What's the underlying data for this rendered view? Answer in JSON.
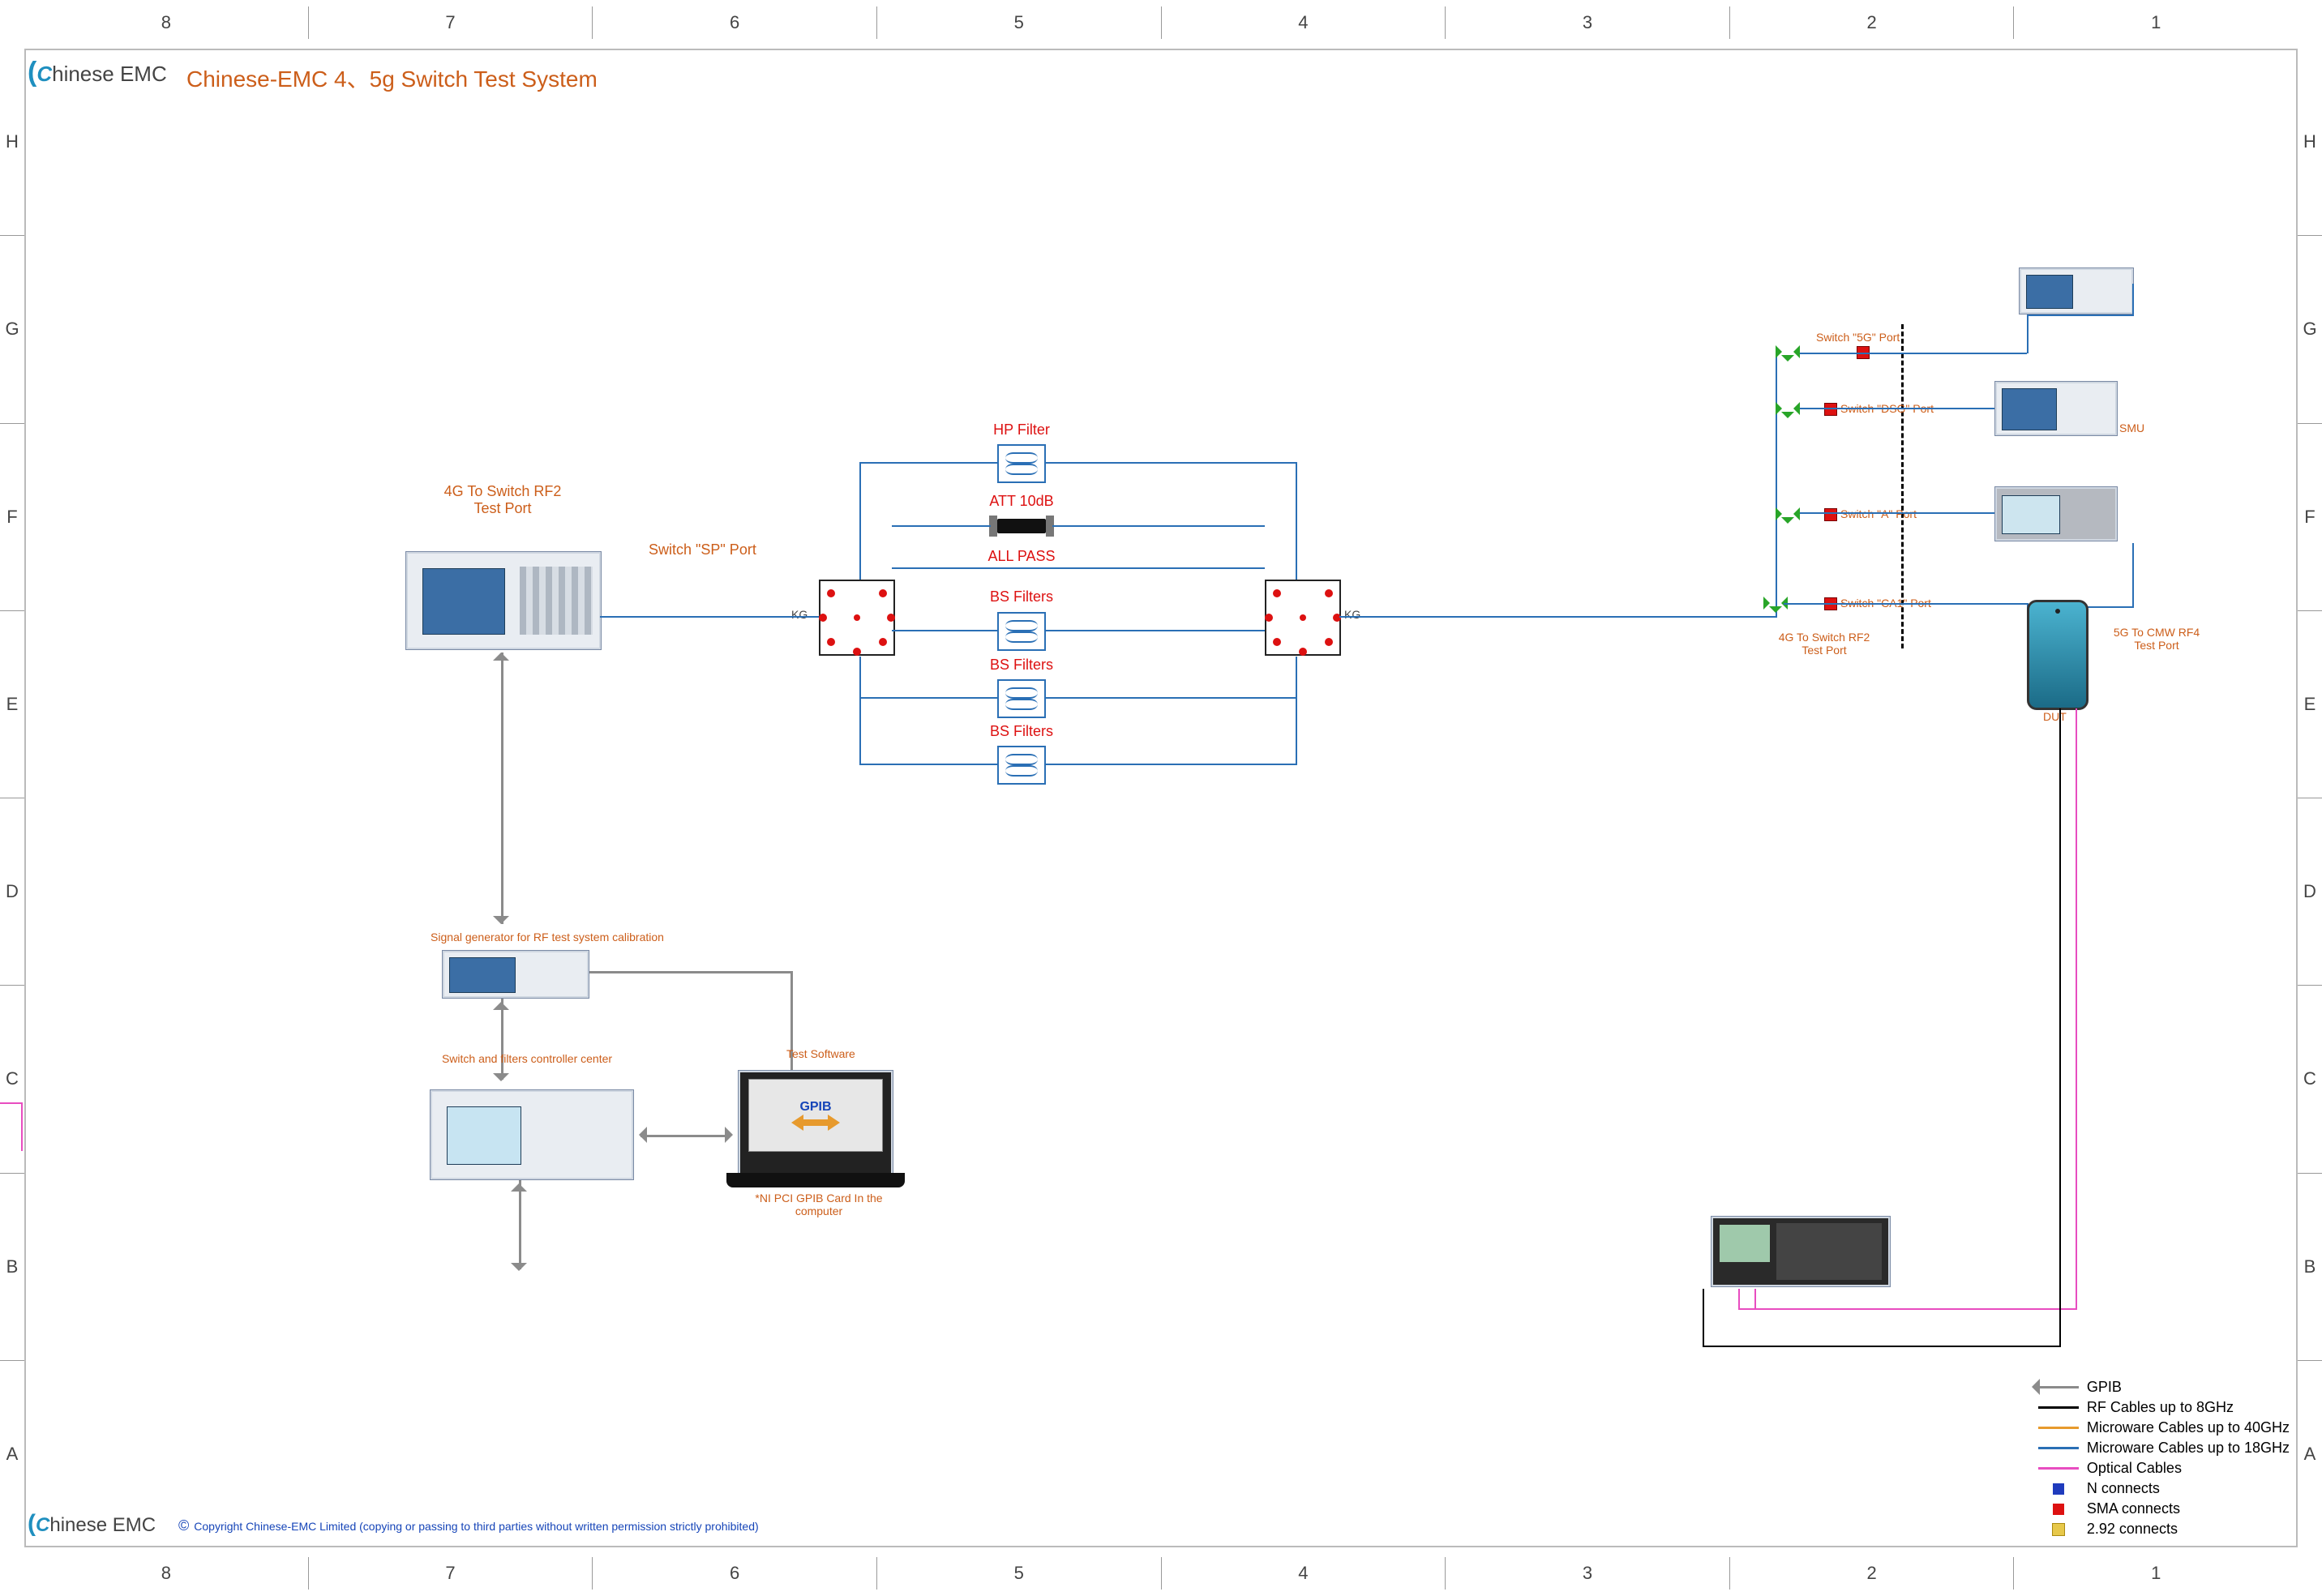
{
  "title": "Chinese-EMC 4、5g Switch Test System",
  "logo_text_pre": "C",
  "logo_text_main": "hinese EMC",
  "copyright": "Copyright Chinese-EMC Limited (copying or passing to third parties without written permission strictly prohibited)",
  "ruler": {
    "cols": [
      "8",
      "7",
      "6",
      "5",
      "4",
      "3",
      "2",
      "1"
    ],
    "rows": [
      "H",
      "G",
      "F",
      "E",
      "D",
      "C",
      "B",
      "A"
    ]
  },
  "labels": {
    "test_port_top": "4G To Switch RF2\nTest Port",
    "switch_sp": "Switch \"SP\" Port",
    "hp_filter": "HP Filter",
    "att": "ATT 10dB",
    "all_pass": "ALL PASS",
    "bs1": "BS Filters",
    "bs2": "BS Filters",
    "bs3": "BS Filters",
    "sig_gen": "Signal generator for RF test system calibration",
    "controller": "Switch and filters controller center",
    "test_sw": "Test Software",
    "gpib_card": "*NI PCI GPIB Card In the computer",
    "gpib": "GPIB",
    "sw_5g": "Switch \"5G\" Port",
    "sw_dsg": "Switch \"DSG\" Port",
    "sw_a": "Switch \"A\" Port",
    "sw_ca1": "Switch \"CA1\" Port",
    "rf2_again": "4G To Switch RF2\nTest Port",
    "rf4": "5G To CMW RF4\nTest Port",
    "dut": "DUT",
    "KG": "KG",
    "SMU": "SMU"
  },
  "legend": {
    "gpib": "GPIB",
    "rf8": "RF Cables up to 8GHz",
    "mw40": "Microware Cables up to 40GHz",
    "mw18": "Microware Cables up to 18GHz",
    "optical": "Optical Cables",
    "n": "N connects",
    "sma": "SMA connects",
    "c292": "2.92 connects"
  }
}
